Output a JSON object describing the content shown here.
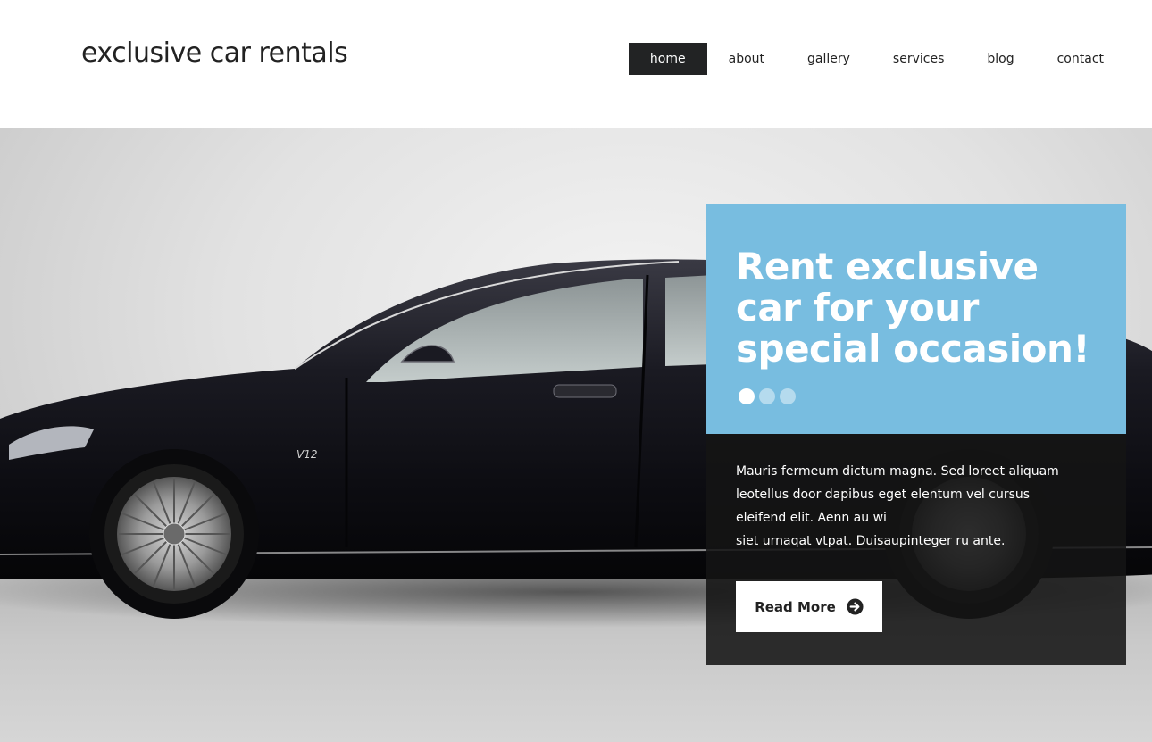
{
  "header": {
    "logo": "exclusive car rentals",
    "nav": [
      {
        "label": "home",
        "active": true
      },
      {
        "label": "about",
        "active": false
      },
      {
        "label": "gallery",
        "active": false
      },
      {
        "label": "services",
        "active": false
      },
      {
        "label": "blog",
        "active": false
      },
      {
        "label": "contact",
        "active": false
      }
    ]
  },
  "hero": {
    "title": "Rent exclusive car for your special occasion!",
    "slide_dots": {
      "count": 3,
      "active_index": 0
    },
    "text_lines": [
      "Mauris fermeum dictum magna. Sed loreet aliquam",
      "leotellus door dapibus eget elentum vel cursus",
      "eleifend elit. Aenn au wi",
      "siet urnaqat vtpat. Duisaupinteger ru ante."
    ],
    "button_label": "Read More",
    "button_icon": "arrow-circle-right-icon",
    "badge_text": "V12",
    "image": "black-luxury-sedan-photo"
  },
  "colors": {
    "accent": "#78bde0",
    "dark_panel": "#141414",
    "nav_active": "#222324",
    "text_dark": "#222222"
  }
}
